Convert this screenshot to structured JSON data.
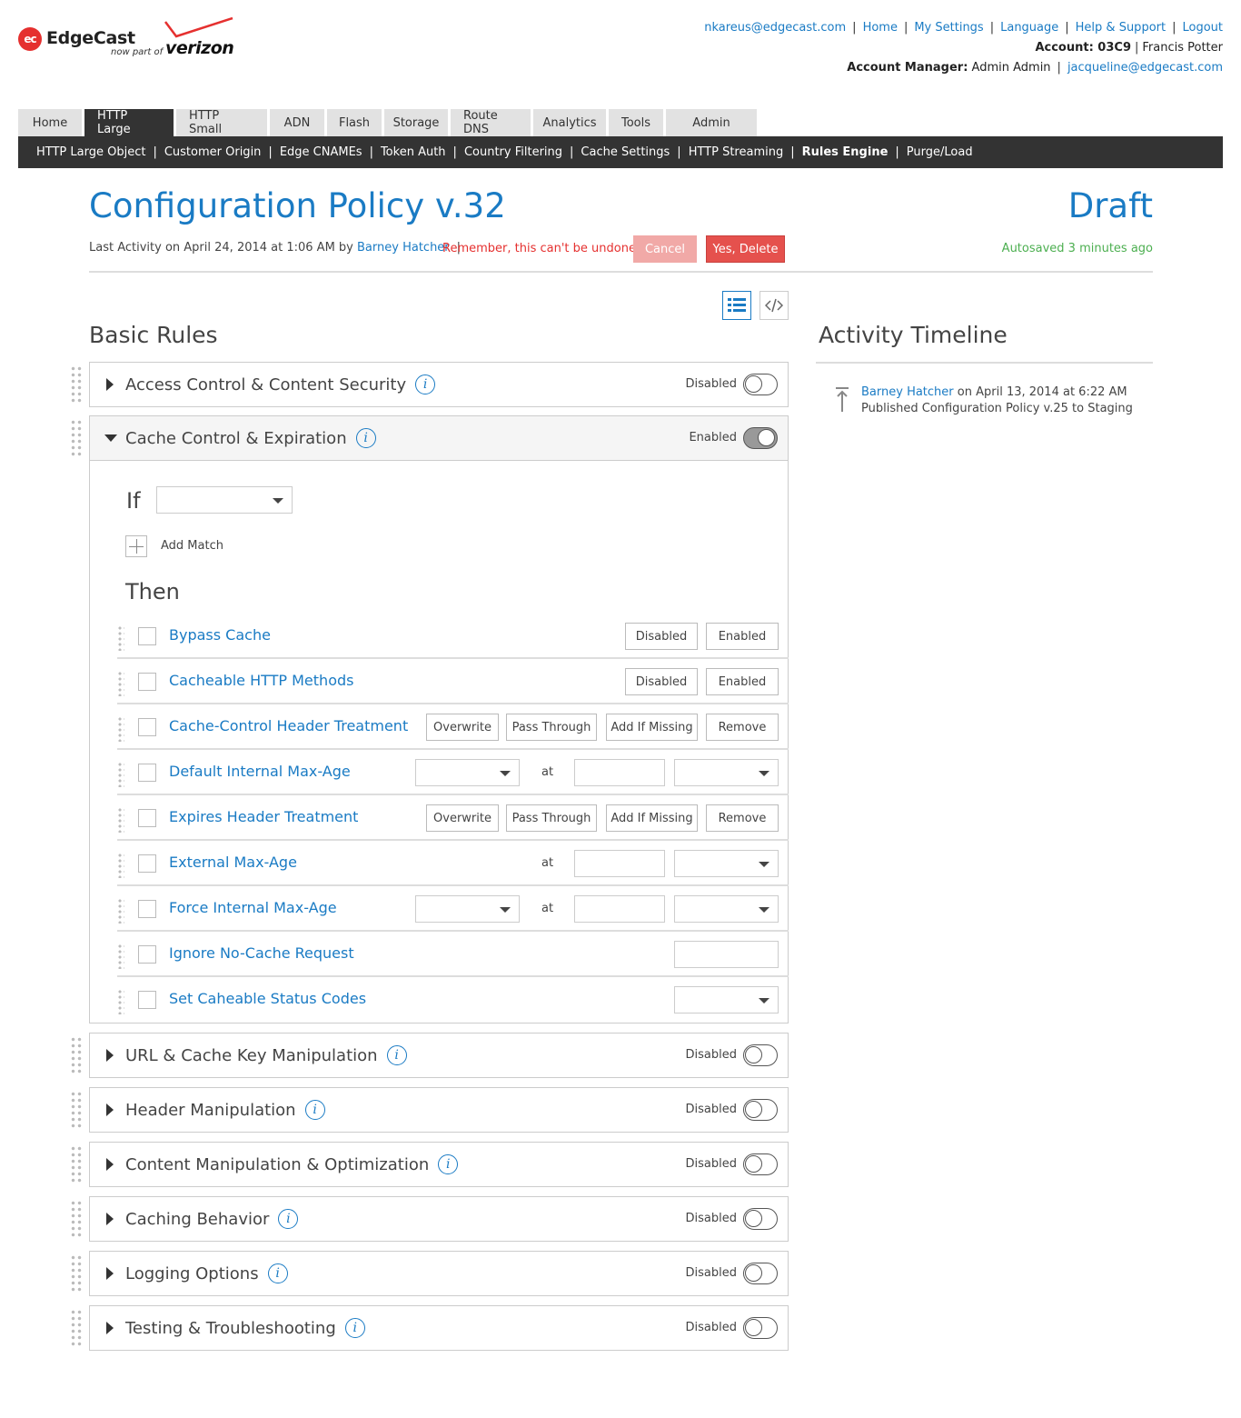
{
  "brand": {
    "badge": "ec",
    "name": "EdgeCast",
    "sub": "now part of",
    "partner": "verizon"
  },
  "toplinks": {
    "user": "nkareus@edgecast.com",
    "home": "Home",
    "settings": "My Settings",
    "language": "Language",
    "help": "Help & Support",
    "logout": "Logout",
    "account_label": "Account: 03C9",
    "account_name": "Francis Potter",
    "manager_label": "Account Manager:",
    "manager_name": "Admin Admin",
    "manager_email": "jacqueline@edgecast.com"
  },
  "tabs": [
    "Home",
    "HTTP Large",
    "HTTP Small",
    "ADN",
    "Flash",
    "Storage",
    "Route DNS",
    "Analytics",
    "Tools",
    "Admin"
  ],
  "active_tab": "HTTP Large",
  "subnav": [
    "HTTP Large Object",
    "Customer Origin",
    "Edge CNAMEs",
    "Token Auth",
    "Country Filtering",
    "Cache Settings",
    "HTTP Streaming",
    "Rules Engine",
    "Purge/Load"
  ],
  "active_subnav": "Rules Engine",
  "policy": {
    "title": "Configuration Policy v.32",
    "state": "Draft",
    "last_activity_prefix": "Last Activity on April 24, 2014 at 1:06 AM by",
    "last_activity_user": "Barney Hatcher",
    "warning": "Remember, this can't be undone!",
    "cancel_label": "Cancel",
    "delete_label": "Yes, Delete",
    "autosaved": "Autosaved 3 minutes ago"
  },
  "basic_rules_title": "Basic Rules",
  "timeline": {
    "title": "Activity Timeline",
    "user": "Barney Hatcher",
    "when": "on April 13, 2014 at 6:22 AM",
    "action": "Published Configuration Policy v.25 to Staging"
  },
  "panels": {
    "access": {
      "name": "Access Control & Content Security",
      "status": "Disabled"
    },
    "cache": {
      "name": "Cache Control & Expiration",
      "status": "Enabled"
    },
    "url": {
      "name": "URL & Cache Key Manipulation",
      "status": "Disabled"
    },
    "header": {
      "name": "Header Manipulation",
      "status": "Disabled"
    },
    "content": {
      "name": "Content Manipulation & Optimization",
      "status": "Disabled"
    },
    "caching": {
      "name": "Caching Behavior",
      "status": "Disabled"
    },
    "logging": {
      "name": "Logging Options",
      "status": "Disabled"
    },
    "testing": {
      "name": "Testing & Troubleshooting",
      "status": "Disabled"
    }
  },
  "cache_body": {
    "if_label": "If",
    "add_match": "Add Match",
    "then_label": "Then",
    "at_label": "at",
    "features": {
      "bypass": "Bypass Cache",
      "methods": "Cacheable HTTP Methods",
      "cc_header": "Cache-Control Header Treatment",
      "default_max_age": "Default Internal Max-Age",
      "expires": "Expires Header Treatment",
      "external": "External Max-Age",
      "force": "Force Internal Max-Age",
      "ignore": "Ignore No-Cache Request",
      "status_codes": "Set Caheable Status Codes"
    },
    "opt_disabled": "Disabled",
    "opt_enabled": "Enabled",
    "opt_overwrite": "Overwrite",
    "opt_pass": "Pass Through",
    "opt_add": "Add If Missing",
    "opt_remove": "Remove"
  }
}
